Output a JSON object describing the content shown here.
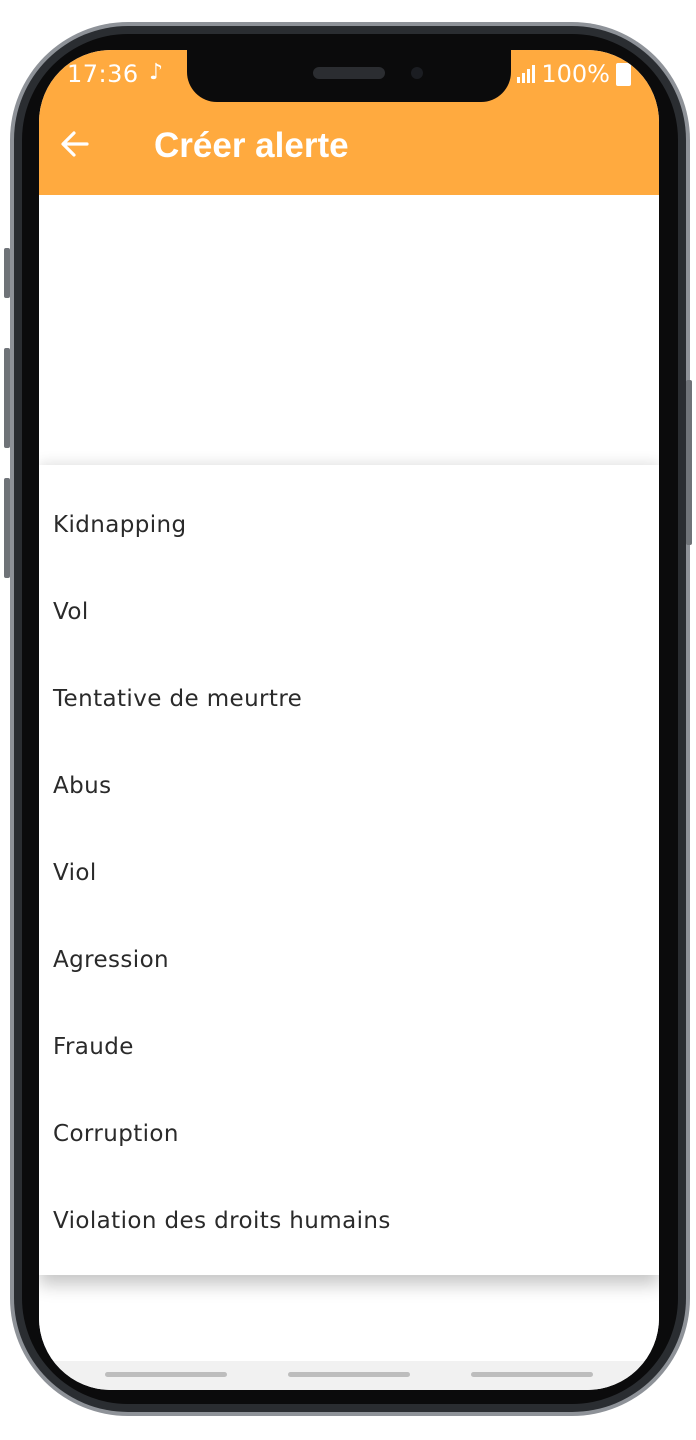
{
  "status_bar": {
    "time": "17:36",
    "music_icon": "♪",
    "battery": "100%",
    "icons": [
      "music-note-icon",
      "signal-icon",
      "battery-icon"
    ]
  },
  "header": {
    "title": "Créer alerte",
    "back_icon": "arrow-left-icon"
  },
  "dropdown": {
    "items": [
      {
        "label": "Kidnapping"
      },
      {
        "label": "Vol"
      },
      {
        "label": "Tentative de meurtre"
      },
      {
        "label": "Abus"
      },
      {
        "label": "Viol"
      },
      {
        "label": "Agression"
      },
      {
        "label": "Fraude"
      },
      {
        "label": "Corruption"
      },
      {
        "label": "Violation des droits humains"
      }
    ]
  },
  "colors": {
    "accent": "#FFAA3F",
    "text": "#2a2a2a"
  }
}
